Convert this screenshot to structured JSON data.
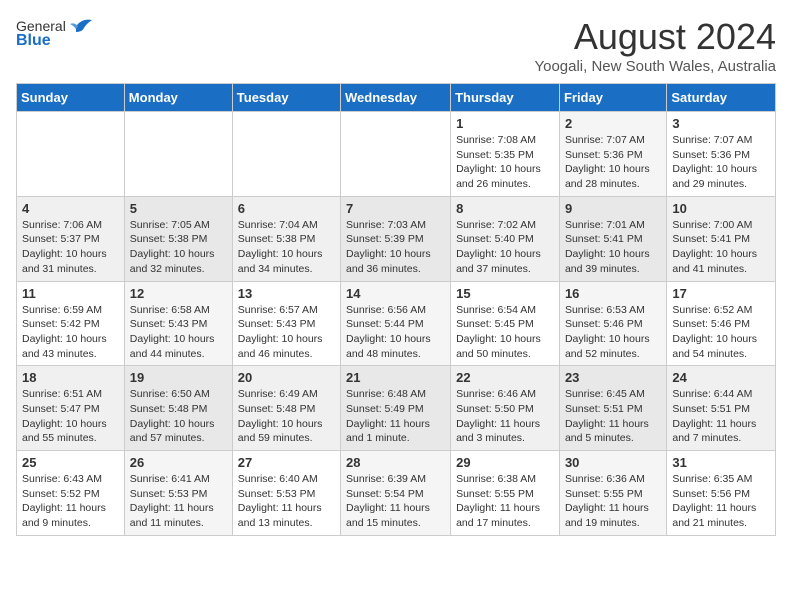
{
  "header": {
    "logo": {
      "general": "General",
      "blue": "Blue"
    },
    "title": "August 2024",
    "subtitle": "Yoogali, New South Wales, Australia"
  },
  "weekdays": [
    "Sunday",
    "Monday",
    "Tuesday",
    "Wednesday",
    "Thursday",
    "Friday",
    "Saturday"
  ],
  "weeks": [
    [
      {
        "day": "",
        "detail": ""
      },
      {
        "day": "",
        "detail": ""
      },
      {
        "day": "",
        "detail": ""
      },
      {
        "day": "",
        "detail": ""
      },
      {
        "day": "1",
        "detail": "Sunrise: 7:08 AM\nSunset: 5:35 PM\nDaylight: 10 hours\nand 26 minutes."
      },
      {
        "day": "2",
        "detail": "Sunrise: 7:07 AM\nSunset: 5:36 PM\nDaylight: 10 hours\nand 28 minutes."
      },
      {
        "day": "3",
        "detail": "Sunrise: 7:07 AM\nSunset: 5:36 PM\nDaylight: 10 hours\nand 29 minutes."
      }
    ],
    [
      {
        "day": "4",
        "detail": "Sunrise: 7:06 AM\nSunset: 5:37 PM\nDaylight: 10 hours\nand 31 minutes."
      },
      {
        "day": "5",
        "detail": "Sunrise: 7:05 AM\nSunset: 5:38 PM\nDaylight: 10 hours\nand 32 minutes."
      },
      {
        "day": "6",
        "detail": "Sunrise: 7:04 AM\nSunset: 5:38 PM\nDaylight: 10 hours\nand 34 minutes."
      },
      {
        "day": "7",
        "detail": "Sunrise: 7:03 AM\nSunset: 5:39 PM\nDaylight: 10 hours\nand 36 minutes."
      },
      {
        "day": "8",
        "detail": "Sunrise: 7:02 AM\nSunset: 5:40 PM\nDaylight: 10 hours\nand 37 minutes."
      },
      {
        "day": "9",
        "detail": "Sunrise: 7:01 AM\nSunset: 5:41 PM\nDaylight: 10 hours\nand 39 minutes."
      },
      {
        "day": "10",
        "detail": "Sunrise: 7:00 AM\nSunset: 5:41 PM\nDaylight: 10 hours\nand 41 minutes."
      }
    ],
    [
      {
        "day": "11",
        "detail": "Sunrise: 6:59 AM\nSunset: 5:42 PM\nDaylight: 10 hours\nand 43 minutes."
      },
      {
        "day": "12",
        "detail": "Sunrise: 6:58 AM\nSunset: 5:43 PM\nDaylight: 10 hours\nand 44 minutes."
      },
      {
        "day": "13",
        "detail": "Sunrise: 6:57 AM\nSunset: 5:43 PM\nDaylight: 10 hours\nand 46 minutes."
      },
      {
        "day": "14",
        "detail": "Sunrise: 6:56 AM\nSunset: 5:44 PM\nDaylight: 10 hours\nand 48 minutes."
      },
      {
        "day": "15",
        "detail": "Sunrise: 6:54 AM\nSunset: 5:45 PM\nDaylight: 10 hours\nand 50 minutes."
      },
      {
        "day": "16",
        "detail": "Sunrise: 6:53 AM\nSunset: 5:46 PM\nDaylight: 10 hours\nand 52 minutes."
      },
      {
        "day": "17",
        "detail": "Sunrise: 6:52 AM\nSunset: 5:46 PM\nDaylight: 10 hours\nand 54 minutes."
      }
    ],
    [
      {
        "day": "18",
        "detail": "Sunrise: 6:51 AM\nSunset: 5:47 PM\nDaylight: 10 hours\nand 55 minutes."
      },
      {
        "day": "19",
        "detail": "Sunrise: 6:50 AM\nSunset: 5:48 PM\nDaylight: 10 hours\nand 57 minutes."
      },
      {
        "day": "20",
        "detail": "Sunrise: 6:49 AM\nSunset: 5:48 PM\nDaylight: 10 hours\nand 59 minutes."
      },
      {
        "day": "21",
        "detail": "Sunrise: 6:48 AM\nSunset: 5:49 PM\nDaylight: 11 hours\nand 1 minute."
      },
      {
        "day": "22",
        "detail": "Sunrise: 6:46 AM\nSunset: 5:50 PM\nDaylight: 11 hours\nand 3 minutes."
      },
      {
        "day": "23",
        "detail": "Sunrise: 6:45 AM\nSunset: 5:51 PM\nDaylight: 11 hours\nand 5 minutes."
      },
      {
        "day": "24",
        "detail": "Sunrise: 6:44 AM\nSunset: 5:51 PM\nDaylight: 11 hours\nand 7 minutes."
      }
    ],
    [
      {
        "day": "25",
        "detail": "Sunrise: 6:43 AM\nSunset: 5:52 PM\nDaylight: 11 hours\nand 9 minutes."
      },
      {
        "day": "26",
        "detail": "Sunrise: 6:41 AM\nSunset: 5:53 PM\nDaylight: 11 hours\nand 11 minutes."
      },
      {
        "day": "27",
        "detail": "Sunrise: 6:40 AM\nSunset: 5:53 PM\nDaylight: 11 hours\nand 13 minutes."
      },
      {
        "day": "28",
        "detail": "Sunrise: 6:39 AM\nSunset: 5:54 PM\nDaylight: 11 hours\nand 15 minutes."
      },
      {
        "day": "29",
        "detail": "Sunrise: 6:38 AM\nSunset: 5:55 PM\nDaylight: 11 hours\nand 17 minutes."
      },
      {
        "day": "30",
        "detail": "Sunrise: 6:36 AM\nSunset: 5:55 PM\nDaylight: 11 hours\nand 19 minutes."
      },
      {
        "day": "31",
        "detail": "Sunrise: 6:35 AM\nSunset: 5:56 PM\nDaylight: 11 hours\nand 21 minutes."
      }
    ]
  ]
}
